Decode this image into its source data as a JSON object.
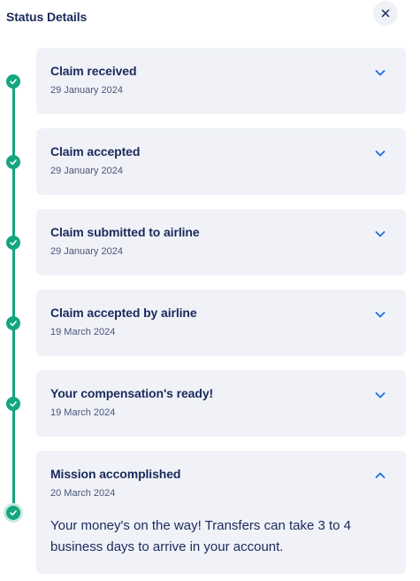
{
  "panel": {
    "title": "Status Details",
    "close_icon": "close-icon"
  },
  "colors": {
    "accent_green": "#14a67e",
    "card_bg": "#f0f2f8",
    "text_dark": "#1b2a5b",
    "chevron_blue": "#1f6ee0"
  },
  "steps": [
    {
      "title": "Claim received",
      "date": "29 January 2024",
      "expanded": false,
      "icon": "check-icon"
    },
    {
      "title": "Claim accepted",
      "date": "29 January 2024",
      "expanded": false,
      "icon": "check-icon"
    },
    {
      "title": "Claim submitted to airline",
      "date": "29 January 2024",
      "expanded": false,
      "icon": "check-icon"
    },
    {
      "title": "Claim accepted by airline",
      "date": "19 March 2024",
      "expanded": false,
      "icon": "check-icon"
    },
    {
      "title": "Your compensation's ready!",
      "date": "19 March 2024",
      "expanded": false,
      "icon": "check-icon"
    },
    {
      "title": "Mission accomplished",
      "date": "20 March 2024",
      "expanded": true,
      "icon": "check-icon",
      "description": "Your money's on the way! Transfers can take 3 to 4 business days to arrive in your account."
    }
  ]
}
